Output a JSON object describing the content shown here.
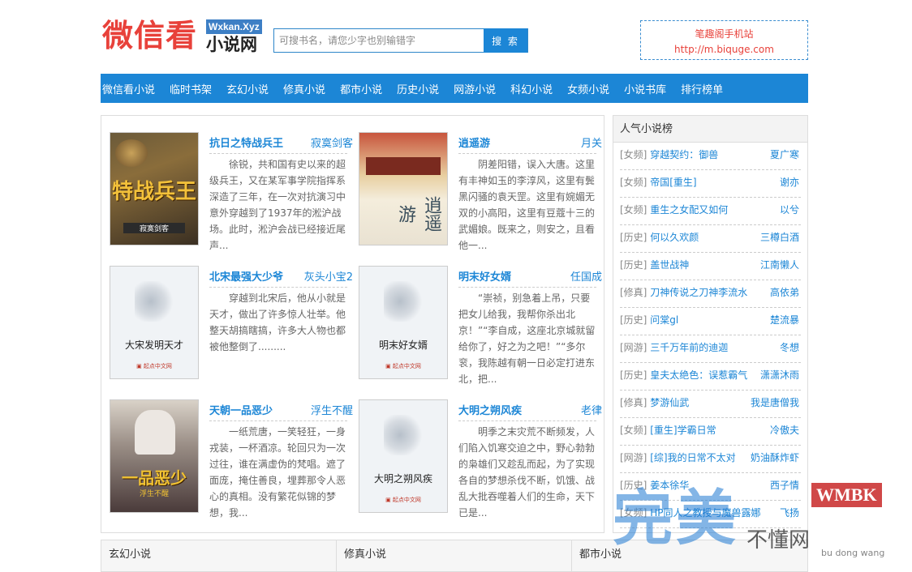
{
  "header": {
    "logo_text": "微信看",
    "logo_domain": "Wxkan.Xyz",
    "logo_sub": "小说网",
    "search_placeholder": "可搜书名，请您少字也别输错字",
    "search_button": "搜 索",
    "mobile_label": "笔趣阁手机站",
    "mobile_url": "http://m.biquge.com"
  },
  "nav": [
    "微信看小说",
    "临时书架",
    "玄幻小说",
    "修真小说",
    "都市小说",
    "历史小说",
    "网游小说",
    "科幻小说",
    "女频小说",
    "小说书库",
    "排行榜单"
  ],
  "books": [
    {
      "title": "抗日之特战兵王",
      "author": "寂寞剑客",
      "desc": "徐锐，共和国有史以来的超级兵王，又在某军事学院指挥系深造了三年，在一次对抗演习中意外穿越到了1937年的淞沪战场。此时，淞沪会战已经接近尾声...",
      "cover": {
        "text": "特战兵王",
        "sub": "寂寞剑客",
        "style": "war"
      }
    },
    {
      "title": "逍遥游",
      "author": "月关",
      "desc": "阴差阳错，误入大唐。这里有丰神如玉的李淳风，这里有鬓黑闪骚的袁天罡。这里有婉媚无双的小高阳，这里有豆蔻十三的武媚娘。既来之，则安之，且看他一...",
      "cover": {
        "text": "逍遥游",
        "sub": "",
        "style": "palace"
      }
    },
    {
      "title": "北宋最强大少爷",
      "author": "灰头小宝2",
      "desc": "穿越到北宋后，他从小就是天才，做出了许多惊人壮举。他整天胡搞瞎搞，许多大人物也都被他整倒了.........",
      "cover": {
        "text": "大宋发明天才",
        "sub": "",
        "style": "blank"
      }
    },
    {
      "title": "明末好女婿",
      "author": "任国成",
      "desc": "“崇祯，别急着上吊，只要把女儿给我，我帮你杀出北京！”“李自成，这座北京城就留给你了，好之为之吧！”“多尔衮，我陈越有朝一日必定打进东北，把...",
      "cover": {
        "text": "明末好女婿",
        "sub": "",
        "style": "blank"
      }
    },
    {
      "title": "天朝一品恶少",
      "author": "浮生不醒",
      "desc": "一纸荒唐，一笑轻狂，一身戎装，一杯酒凉。轮回只为一次过往，谁在满虚伪的梵唱。遮了面庞，掩住善良，埋葬那令人恶心的真相。没有繁花似锦的梦想，我...",
      "cover": {
        "text": "一品恶少",
        "sub": "浮生不醒",
        "style": "hero"
      }
    },
    {
      "title": "大明之朔风疾",
      "author": "老律",
      "desc": "明季之末灾荒不断频发，人们陷入饥寒交迫之中，野心勃勃的枭雄们又趁乱而起，为了实现各自的梦想杀伐不断，饥饿、战乱大批吞噬着人们的生命，天下已是...",
      "cover": {
        "text": "大明之朔风疾",
        "sub": "",
        "style": "blank"
      }
    }
  ],
  "ranking": {
    "title": "人气小说榜",
    "items": [
      {
        "cat": "[女频]",
        "name": "穿越契约：御兽",
        "author": "夏广寒"
      },
      {
        "cat": "[女频]",
        "name": "帝国[重生]",
        "author": "谢亦"
      },
      {
        "cat": "[女频]",
        "name": "重生之女配又如何",
        "author": "以兮"
      },
      {
        "cat": "[历史]",
        "name": "何以久欢颜",
        "author": "三樽白酒"
      },
      {
        "cat": "[历史]",
        "name": "盖世战神",
        "author": "江南懒人"
      },
      {
        "cat": "[修真]",
        "name": "刀神传说之刀神李流水",
        "author": "高依弟"
      },
      {
        "cat": "[历史]",
        "name": "问棠gl",
        "author": "楚流暴"
      },
      {
        "cat": "[网游]",
        "name": "三千万年前的迪迦",
        "author": "冬想"
      },
      {
        "cat": "[历史]",
        "name": "皇夫太绝色：误惹霸气",
        "author": "潇潇沐雨"
      },
      {
        "cat": "[修真]",
        "name": "梦游仙武",
        "author": "我是唐僧我"
      },
      {
        "cat": "[女频]",
        "name": "[重生]学霸日常",
        "author": "冷傲夫"
      },
      {
        "cat": "[网游]",
        "name": "[综]我的日常不太对",
        "author": "奶油酥炸虾"
      },
      {
        "cat": "[历史]",
        "name": "姜本徐华",
        "author": "西子情"
      },
      {
        "cat": "[女频]",
        "name": "HP同人之教授与魔兽露娜",
        "author": "飞扬"
      }
    ]
  },
  "bottom": [
    "玄幻小说",
    "修真小说",
    "都市小说"
  ],
  "watermark": {
    "big": "完美",
    "logo": "WMBK",
    "sub": "不懂网",
    "pinyin": "bu dong wang"
  }
}
